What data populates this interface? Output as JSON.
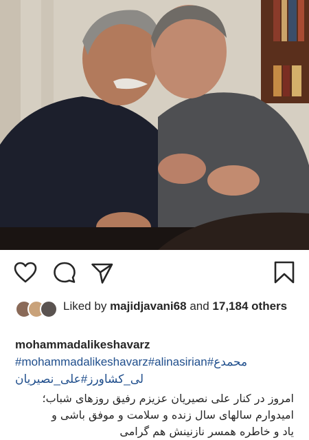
{
  "post": {
    "photo_alt": "",
    "colors": {
      "background": "#ffffff",
      "text": "#262626",
      "hashtag": "#1f4e8c"
    }
  },
  "actions": {
    "icons": [
      "heart-icon",
      "comment-icon",
      "share-icon",
      "bookmark-icon"
    ]
  },
  "likes": {
    "prefix": "Liked by",
    "user": "majidjavani68",
    "middle": "and",
    "count": "17,184",
    "suffix": "others"
  },
  "caption": {
    "username": "mohammadalikeshavarz",
    "hashtags_line1": "#mohammadalikeshavarz#alinasirian#محمدع",
    "hashtags_line2": "لی_کشاورز#علی_نصیریان",
    "text_line1": "امروز در کنار علی نصیریان عزیزم رفیق روزهای شباب؛",
    "text_line2": "امیدوارم سالهای سال زنده و سلامت و موفق باشی و",
    "text_line3": "یاد و خاطره همسر نازنینش هم گرامی"
  }
}
